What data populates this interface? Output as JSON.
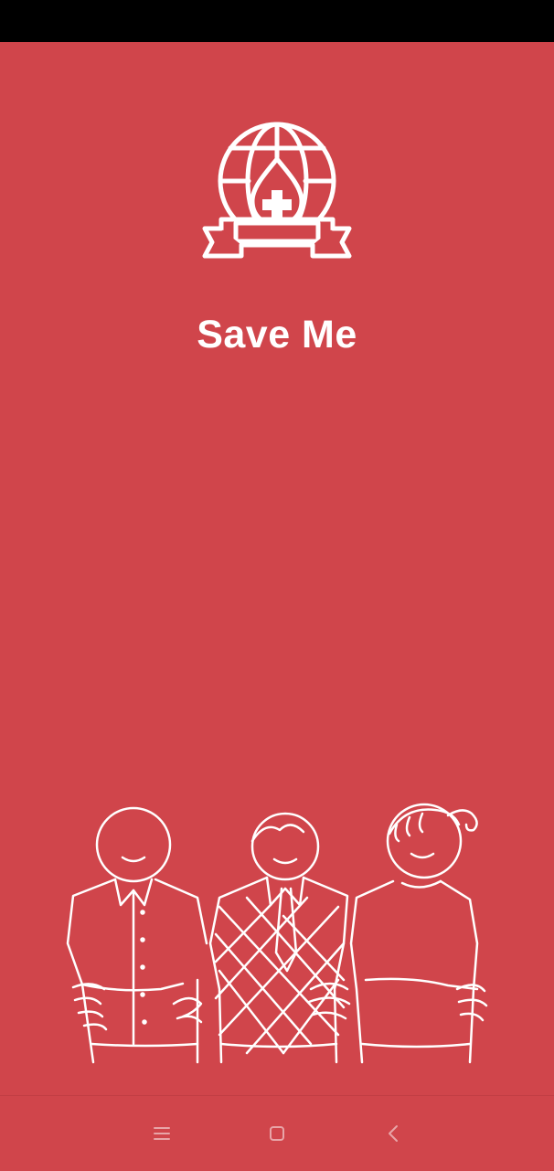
{
  "app": {
    "title": "Save Me"
  },
  "icons": {
    "logo": "globe-blood-drop-banner-icon",
    "illustration": "three-people-embracing-illustration",
    "nav_menu": "menu-icon",
    "nav_home": "home-square-icon",
    "nav_back": "back-chevron-icon"
  },
  "colors": {
    "background": "#d0454b",
    "status_bar": "#000000",
    "foreground": "#ffffff"
  }
}
